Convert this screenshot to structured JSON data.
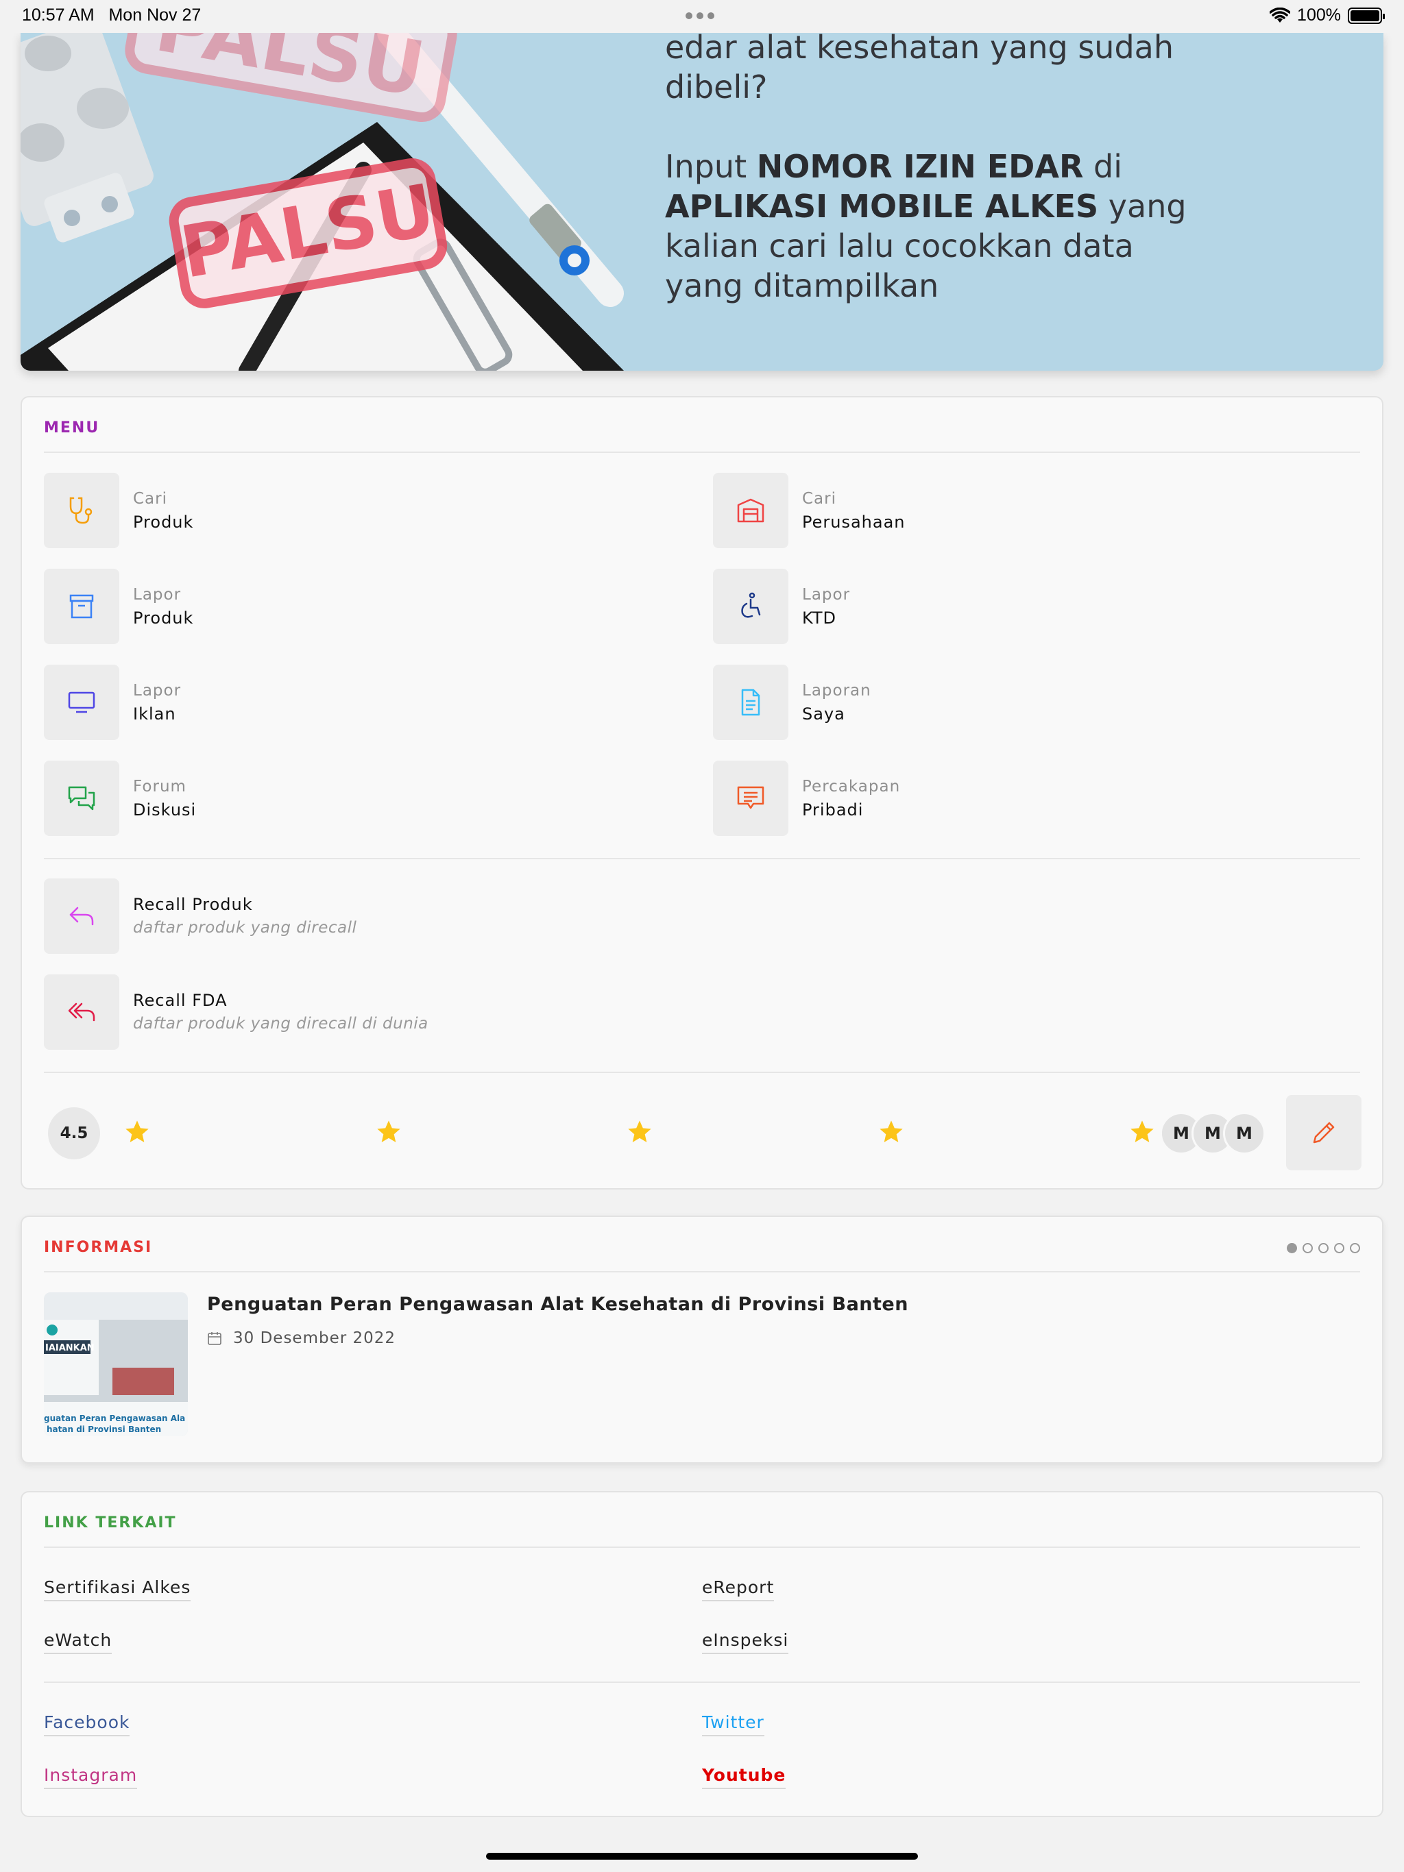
{
  "status_bar": {
    "time": "10:57 AM",
    "date": "Mon Nov 27",
    "battery": "100%"
  },
  "banner": {
    "stamp1": "PALSU",
    "stamp2": "PALSU",
    "line1": "edar alat kesehatan yang sudah",
    "line2": "dibeli?",
    "input_prefix": "Input ",
    "input_bold": "NOMOR IZIN EDAR",
    "input_suffix": " di",
    "app_bold": "APLIKASI MOBILE ALKES",
    "app_suffix": " yang",
    "line5": "kalian cari lalu cocokkan data",
    "line6": "yang ditampilkan"
  },
  "menu": {
    "title": "MENU",
    "title_color": "#9c27b0",
    "items": [
      {
        "sub": "Cari",
        "main": "Produk",
        "icon": "stethoscope-icon",
        "color": "#f59e0b"
      },
      {
        "sub": "Cari",
        "main": "Perusahaan",
        "icon": "warehouse-icon",
        "color": "#ef4444"
      },
      {
        "sub": "Lapor",
        "main": "Produk",
        "icon": "archive-box-icon",
        "color": "#3b82f6"
      },
      {
        "sub": "Lapor",
        "main": "KTD",
        "icon": "wheelchair-icon",
        "color": "#1e3a8a"
      },
      {
        "sub": "Lapor",
        "main": "Iklan",
        "icon": "monitor-icon",
        "color": "#4f46e5"
      },
      {
        "sub": "Laporan",
        "main": "Saya",
        "icon": "document-icon",
        "color": "#38bdf8"
      },
      {
        "sub": "Forum",
        "main": "Diskusi",
        "icon": "chat-bubbles-icon",
        "color": "#22a34a"
      },
      {
        "sub": "Percakapan",
        "main": "Pribadi",
        "icon": "message-icon",
        "color": "#f05a28"
      }
    ],
    "recalls": [
      {
        "title": "Recall Produk",
        "desc": "daftar produk yang direcall",
        "icon": "reply-icon",
        "color": "#d946ef"
      },
      {
        "title": "Recall FDA",
        "desc": "daftar produk yang direcall di dunia",
        "icon": "reply-all-icon",
        "color": "#e11d48"
      }
    ],
    "rating": {
      "score": "4.5",
      "stars": 5,
      "avatars": [
        "M",
        "M",
        "M"
      ]
    }
  },
  "informasi": {
    "title": "INFORMASI",
    "title_color": "#e53935",
    "pages": 5,
    "active_page": 1,
    "news": {
      "title": "Penguatan Peran Pengawasan Alat Kesehatan di Provinsi Banten",
      "date": "30 Desember 2022",
      "thumb_label": "IAIANKAN",
      "thumb_caption1": "guatan Peran Pengawasan Ala",
      "thumb_caption2": "hatan di Provinsi Banten"
    }
  },
  "links": {
    "title": "LINK TERKAIT",
    "title_color": "#43a047",
    "internal": [
      "Sertifikasi Alkes",
      "eReport",
      "eWatch",
      "eInspeksi"
    ],
    "social": [
      {
        "label": "Facebook",
        "color": "#3b5998"
      },
      {
        "label": "Twitter",
        "color": "#1da1f2"
      },
      {
        "label": "Instagram",
        "color": "#c13584"
      },
      {
        "label": "Youtube",
        "color": "#e00000"
      }
    ]
  }
}
